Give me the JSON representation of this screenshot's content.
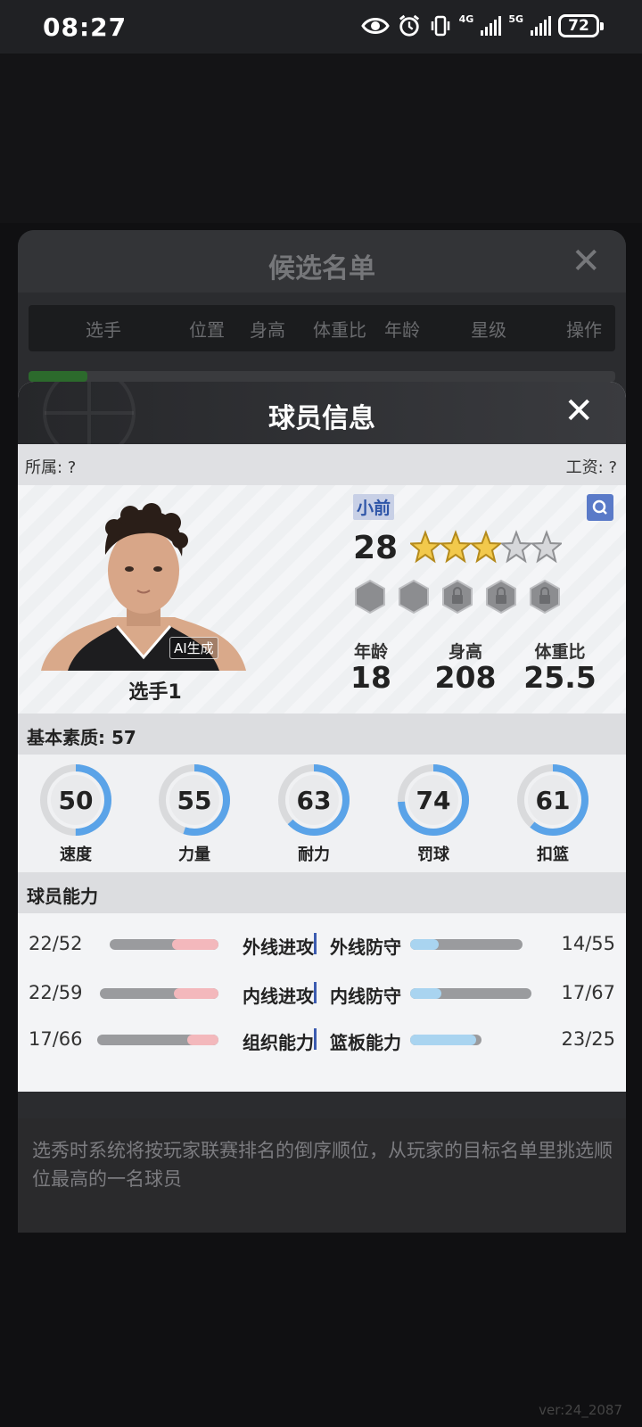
{
  "status_bar": {
    "time": "08:27",
    "network_1": "4G",
    "network_2": "5G",
    "battery": "72"
  },
  "outer_modal": {
    "title": "候选名单",
    "close": "✕",
    "columns": [
      "选手",
      "位置",
      "身高",
      "体重比",
      "年龄",
      "星级",
      "操作"
    ],
    "note": "选秀时系统将按玩家联赛排名的倒序顺位，从玩家的目标名单里挑选顺位最高的一名球员"
  },
  "version": "ver:24_2087",
  "player_dialog": {
    "title": "球员信息",
    "close": "✕",
    "affiliation": "所属: ?",
    "salary": "工资: ?",
    "ai_badge": "AI生成",
    "name": "选手1",
    "position": "小前",
    "overall": "28",
    "stars": {
      "rating": 3,
      "max": 5
    },
    "bio": [
      {
        "label": "年龄",
        "value": "18"
      },
      {
        "label": "身高",
        "value": "208"
      },
      {
        "label": "体重比",
        "value": "25.5"
      }
    ],
    "basic_title": "基本素质: 57",
    "attributes": [
      {
        "label": "速度",
        "value": "50"
      },
      {
        "label": "力量",
        "value": "55"
      },
      {
        "label": "耐力",
        "value": "63"
      },
      {
        "label": "罚球",
        "value": "74"
      },
      {
        "label": "扣篮",
        "value": "61"
      }
    ],
    "abilities_title": "球员能力",
    "abilities": [
      {
        "left_value": "22/52",
        "left_label": "外线进攻",
        "right_label": "外线防守",
        "right_value": "14/55"
      },
      {
        "left_value": "22/59",
        "left_label": "内线进攻",
        "right_label": "内线防守",
        "right_value": "17/67"
      },
      {
        "left_value": "17/66",
        "left_label": "组织能力",
        "right_label": "篮板能力",
        "right_value": "23/25"
      }
    ],
    "colors": {
      "ring": "#5aa3e8",
      "ring_track": "#d9dadc",
      "bar_red": "#f3b8bc",
      "bar_blue": "#a9d4f0"
    }
  }
}
